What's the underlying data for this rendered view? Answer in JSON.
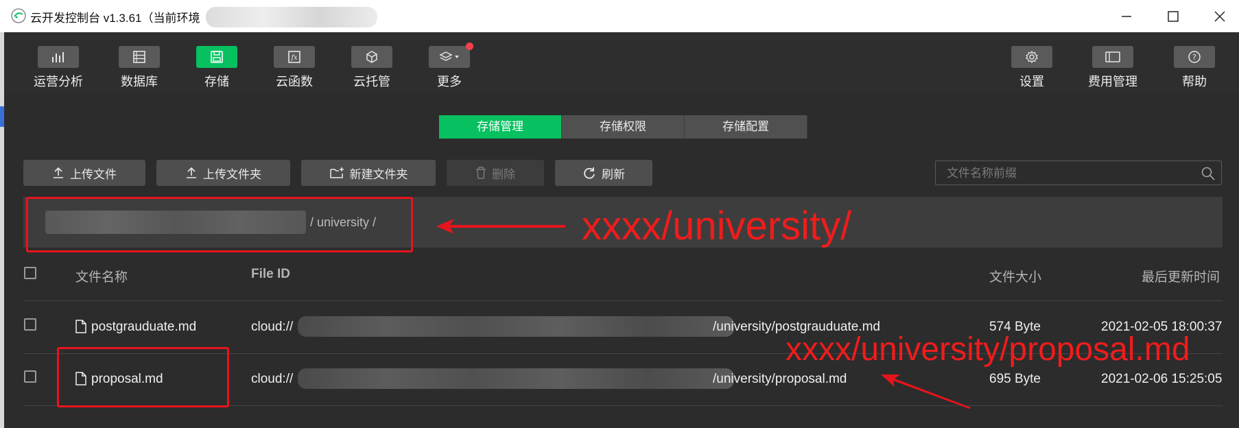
{
  "window": {
    "title": "云开发控制台 v1.3.61（当前环境"
  },
  "nav": {
    "left": [
      {
        "label": "运营分析",
        "icon": "bar-chart-icon"
      },
      {
        "label": "数据库",
        "icon": "database-icon"
      },
      {
        "label": "存储",
        "icon": "storage-icon",
        "active": true
      },
      {
        "label": "云函数",
        "icon": "function-icon"
      },
      {
        "label": "云托管",
        "icon": "cube-icon"
      },
      {
        "label": "更多",
        "icon": "layers-icon",
        "badge": true
      }
    ],
    "right": [
      {
        "label": "设置",
        "icon": "gear-icon"
      },
      {
        "label": "费用管理",
        "icon": "billing-icon"
      },
      {
        "label": "帮助",
        "icon": "help-icon"
      }
    ]
  },
  "tabs": [
    {
      "label": "存储管理",
      "active": true
    },
    {
      "label": "存储权限",
      "active": false
    },
    {
      "label": "存储配置",
      "active": false
    }
  ],
  "toolbar": {
    "upload_file": "上传文件",
    "upload_folder": "上传文件夹",
    "new_folder": "新建文件夹",
    "delete": "删除",
    "refresh": "刷新"
  },
  "search": {
    "placeholder": "文件名称前缀",
    "value": ""
  },
  "path": {
    "visible_text": "/ university /"
  },
  "table": {
    "headers": {
      "name": "文件名称",
      "file_id": "File ID",
      "size": "文件大小",
      "updated": "最后更新时间"
    },
    "rows": [
      {
        "name": "postgrauduate.md",
        "id_prefix": "cloud://",
        "id_suffix": "/university/postgrauduate.md",
        "size": "574 Byte",
        "updated": "2021-02-05 18:00:37"
      },
      {
        "name": "proposal.md",
        "id_prefix": "cloud://",
        "id_suffix": "/university/proposal.md",
        "size": "695 Byte",
        "updated": "2021-02-06 15:25:05"
      }
    ]
  },
  "annotations": {
    "path_note": "xxxx/university/",
    "file_note": "xxxx/university/proposal.md",
    "color": "#f01c1c"
  },
  "colors": {
    "accent": "#07c160",
    "background": "#2c2c2c",
    "annotation": "#e8141c"
  }
}
